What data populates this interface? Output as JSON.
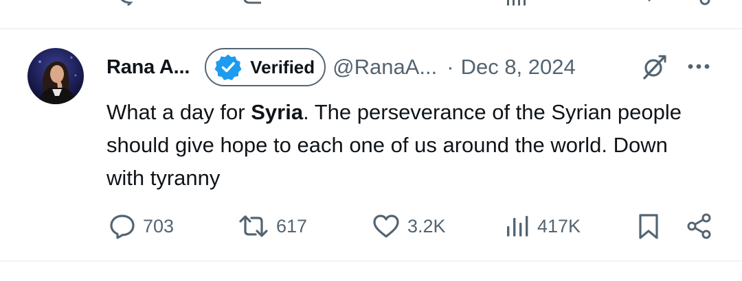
{
  "tweet": {
    "author_name": "Rana A...",
    "verified_label": "Verified",
    "handle": "@RanaA...",
    "separator": "·",
    "date": "Dec 8, 2024",
    "text": {
      "part1": "What a day for ",
      "bold": "Syria",
      "part2": ". The perseverance of the Syrian people should give hope to each one of us around the world. Down with tyranny"
    },
    "stats": {
      "replies": "703",
      "reposts": "617",
      "likes": "3.2K",
      "views": "417K"
    }
  },
  "colors": {
    "verified_blue": "#1d9bf0",
    "secondary_text": "#536471",
    "divider": "#eff3f4"
  },
  "icons": [
    "verified-check-icon",
    "grok-icon",
    "more-icon",
    "reply-icon",
    "repost-icon",
    "like-icon",
    "views-icon",
    "bookmark-icon",
    "share-icon"
  ]
}
